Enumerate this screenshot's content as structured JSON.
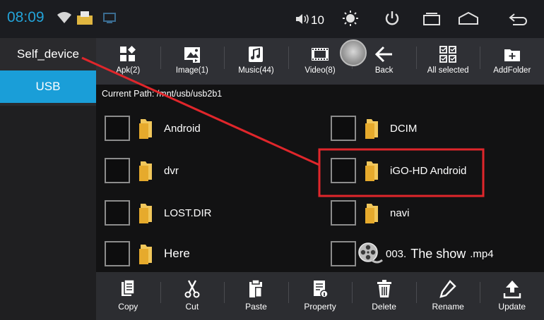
{
  "statusbar": {
    "time": "08:09",
    "volume": "10",
    "icons": [
      "wifi-icon",
      "sd-card-icon",
      "screen-icon",
      "volume-icon",
      "brightness-icon",
      "power-icon",
      "recent-apps-icon",
      "home-icon",
      "back-icon"
    ]
  },
  "sidebar": {
    "items": [
      {
        "label": "Self_device",
        "icon": "none",
        "active": false
      },
      {
        "label": "USB",
        "icon": "none",
        "active": true
      }
    ]
  },
  "toolbar": {
    "items": [
      {
        "label": "Apk(2)",
        "icon": "apk-icon"
      },
      {
        "label": "Image(1)",
        "icon": "image-icon"
      },
      {
        "label": "Music(44)",
        "icon": "music-icon"
      },
      {
        "label": "Video(8)",
        "icon": "video-icon"
      },
      {
        "label": "Back",
        "icon": "back-arrow-icon"
      },
      {
        "label": "All selected",
        "icon": "select-all-icon"
      },
      {
        "label": "AddFolder",
        "icon": "add-folder-icon"
      }
    ]
  },
  "content": {
    "path": "Current Path:  /mnt/usb/usb2b1",
    "files": [
      {
        "name": "Android",
        "type": "folder"
      },
      {
        "name": "DCIM",
        "type": "folder"
      },
      {
        "name": "dvr",
        "type": "folder"
      },
      {
        "name": "iGO-HD Android",
        "type": "folder",
        "highlighted": true
      },
      {
        "name": "LOST.DIR",
        "type": "folder"
      },
      {
        "name": "navi",
        "type": "folder"
      },
      {
        "name": "Here",
        "type": "folder"
      },
      {
        "name": "003.",
        "name_mid": "The show",
        "name_ext": ".mp4",
        "type": "video"
      }
    ]
  },
  "bottombar": {
    "items": [
      {
        "label": "Copy",
        "icon": "copy-icon"
      },
      {
        "label": "Cut",
        "icon": "scissors-icon"
      },
      {
        "label": "Paste",
        "icon": "paste-icon"
      },
      {
        "label": "Property",
        "icon": "property-icon"
      },
      {
        "label": "Delete",
        "icon": "trash-icon"
      },
      {
        "label": "Rename",
        "icon": "pencil-icon"
      },
      {
        "label": "Update",
        "icon": "upload-icon"
      }
    ]
  },
  "colors": {
    "accent": "#1a9ed8",
    "annotation": "#e0262b"
  }
}
